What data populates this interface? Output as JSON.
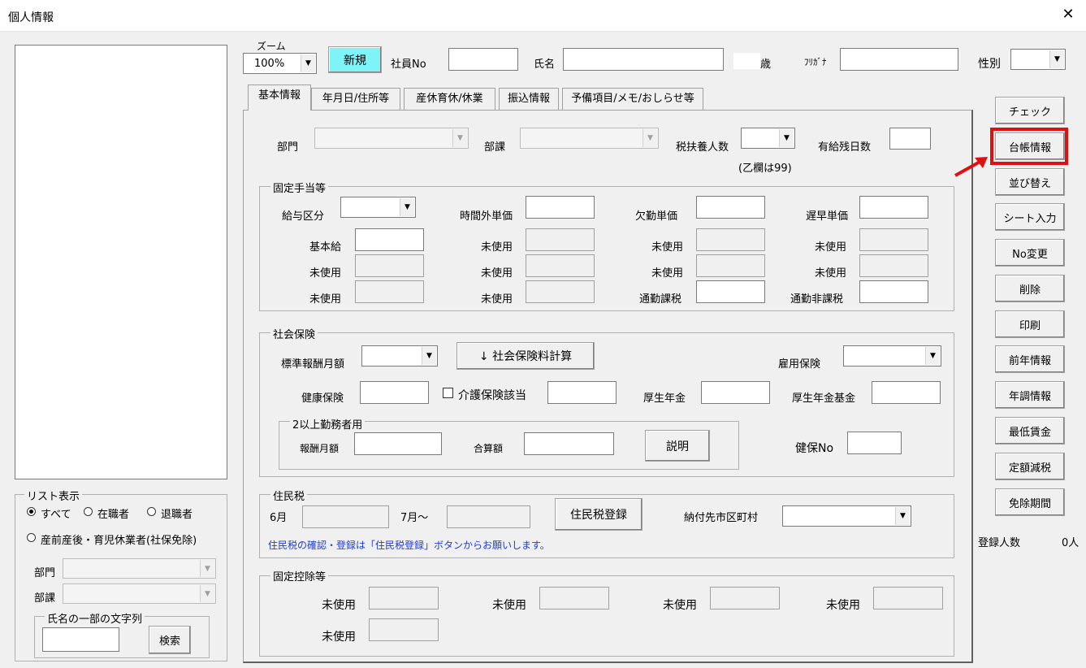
{
  "window": {
    "title": "個人情報",
    "close_symbol": "✕"
  },
  "top": {
    "zoom_label": "ズーム",
    "zoom_value": "100%",
    "new_button": "新規",
    "employee_no_label": "社員No",
    "name_label": "氏名",
    "age_unit": "歳",
    "kana_label": "ﾌﾘｶﾞﾅ",
    "gender_label": "性別"
  },
  "tabs": [
    "基本情報",
    "年月日/住所等",
    "産休育休/休業",
    "振込情報",
    "予備項目/メモ/おしらせ等"
  ],
  "basic": {
    "dept_label": "部門",
    "section_label": "部課",
    "dependents_label": "税扶養人数",
    "dependents_note": "(乙欄は99)",
    "paid_leave_label": "有給残日数"
  },
  "allowance": {
    "title": "固定手当等",
    "pay_type_label": "給与区分",
    "overtime_label": "時間外単価",
    "absence_label": "欠勤単価",
    "late_label": "遅早単価",
    "base_pay_label": "基本給",
    "unused": "未使用",
    "commute_taxable": "通勤課税",
    "commute_nontaxable": "通勤非課税"
  },
  "social": {
    "title": "社会保険",
    "std_monthly_label": "標準報酬月額",
    "calc_button": "↓  社会保険料計算",
    "employment_ins_label": "雇用保険",
    "health_label": "健康保険",
    "care_label": "介護保険該当",
    "pension_label": "厚生年金",
    "pension_fund_label": "厚生年金基金",
    "multi_title": "2以上勤務者用",
    "reward_label": "報酬月額",
    "total_label": "合算額",
    "explain_button": "説明",
    "health_no_label": "健保No"
  },
  "resident_tax": {
    "title": "住民税",
    "june_label": "6月",
    "july_label": "7月～",
    "register_button": "住民税登録",
    "municipality_label": "納付先市区町村",
    "note": "住民税の確認・登録は「住民税登録」ボタンからお願いします。"
  },
  "deduction": {
    "title": "固定控除等",
    "unused": "未使用"
  },
  "side_buttons": [
    "チェック",
    "台帳情報",
    "並び替え",
    "シート入力",
    "No変更",
    "削除",
    "印刷",
    "前年情報",
    "年調情報",
    "最低賃金",
    "定額減税",
    "免除期間"
  ],
  "registered": {
    "label": "登録人数",
    "count": "0人"
  },
  "list_display": {
    "title": "リスト表示",
    "all": "すべて",
    "employed": "在職者",
    "retired": "退職者",
    "leave": "産前産後・育児休業者(社保免除)",
    "dept_label": "部門",
    "section_label": "部課",
    "partial_title": "氏名の一部の文字列",
    "search_button": "検索"
  },
  "colors": {
    "new_button_bg": "#7ff4f8",
    "highlight": "#e01010",
    "note_text": "#1e3cd4"
  }
}
